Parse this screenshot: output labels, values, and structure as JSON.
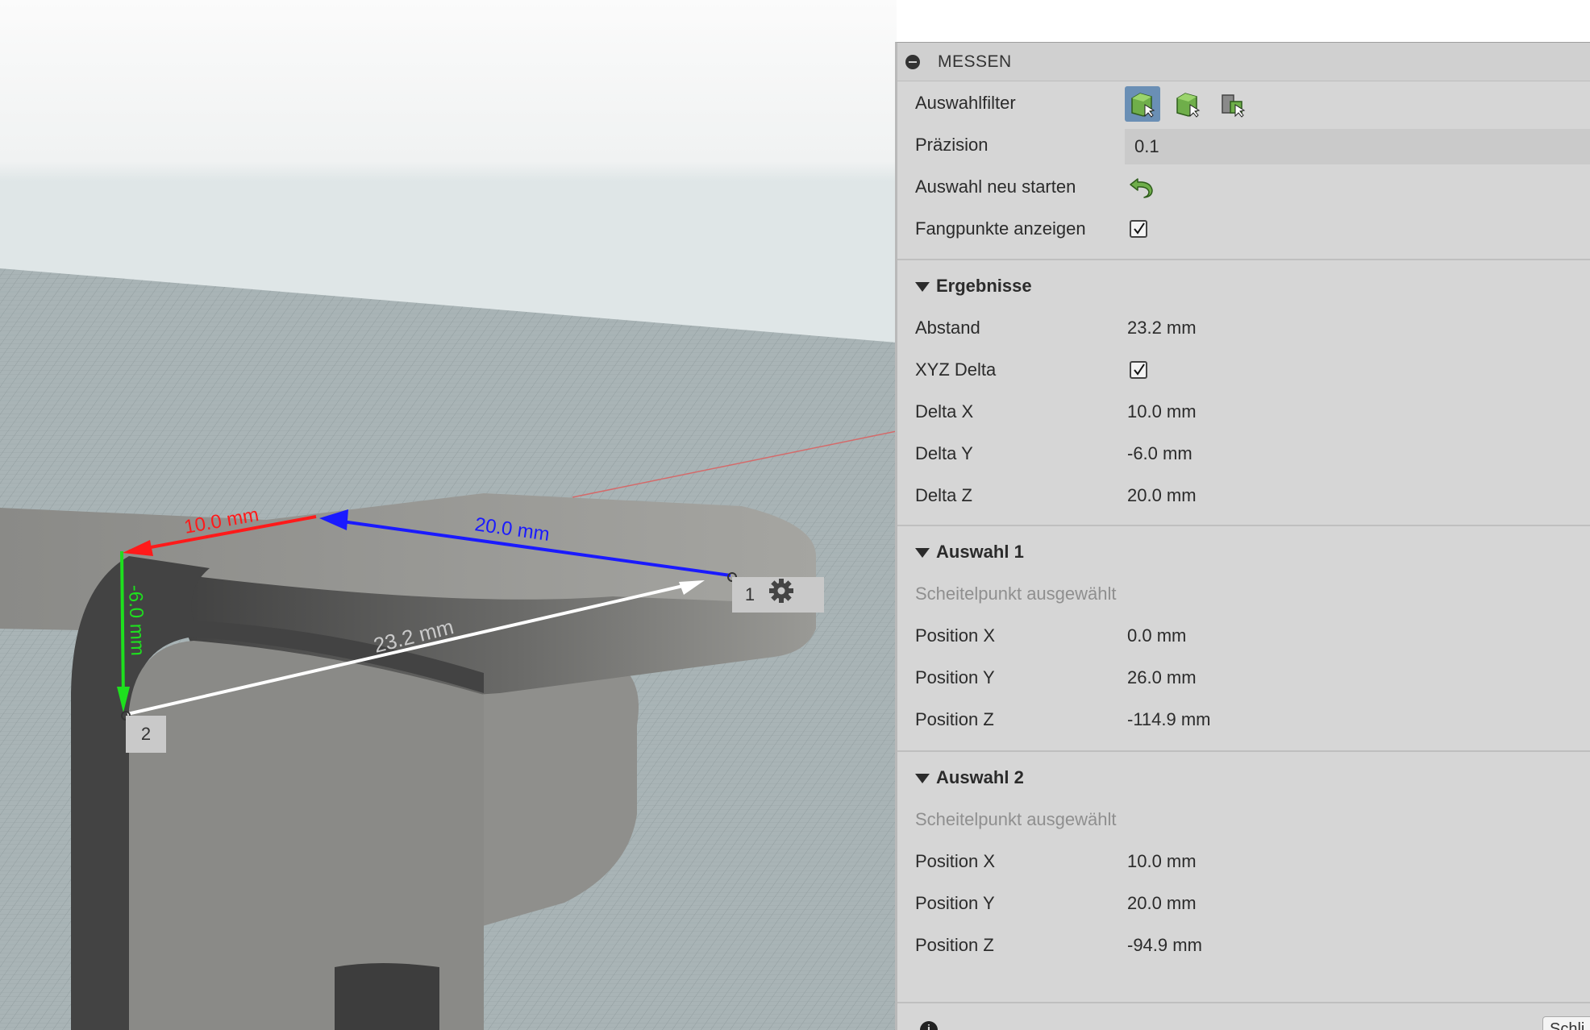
{
  "viewport": {
    "dimensions": {
      "delta_x": "10.0 mm",
      "delta_z": "20.0 mm",
      "delta_y": "-6.0 mm",
      "distance": "23.2 mm"
    },
    "point_labels": [
      "1",
      "2"
    ],
    "colors": {
      "x_axis": "#ff1a1a",
      "y_axis": "#1ee01e",
      "z_axis": "#1a1aff",
      "distance": "#ffffff",
      "model": "#8e8e8b",
      "model_dark": "#444444",
      "grid": "#9aa7a9"
    }
  },
  "panel": {
    "title": "MESSEN",
    "selection_filter": {
      "label": "Auswahlfilter",
      "icons": [
        "select-face-icon",
        "select-body-icon",
        "select-component-icon"
      ]
    },
    "precision": {
      "label": "Präzision",
      "value": "0.1"
    },
    "reset_selection": {
      "label": "Auswahl neu starten",
      "icon": "undo-arrow-icon"
    },
    "show_snap_points": {
      "label": "Fangpunkte anzeigen",
      "checked": true
    },
    "results": {
      "heading": "Ergebnisse",
      "distance_label": "Abstand",
      "distance_value": "23.2 mm",
      "xyz_delta_label": "XYZ Delta",
      "xyz_delta_checked": true,
      "delta_x_label": "Delta X",
      "delta_x_value": "10.0 mm",
      "delta_y_label": "Delta Y",
      "delta_y_value": "-6.0 mm",
      "delta_z_label": "Delta Z",
      "delta_z_value": "20.0 mm"
    },
    "selection1": {
      "heading": "Auswahl 1",
      "status": "Scheitelpunkt ausgewählt",
      "pos_x_label": "Position X",
      "pos_x_value": "0.0 mm",
      "pos_y_label": "Position Y",
      "pos_y_value": "26.0 mm",
      "pos_z_label": "Position Z",
      "pos_z_value": "-114.9 mm"
    },
    "selection2": {
      "heading": "Auswahl 2",
      "status": "Scheitelpunkt ausgewählt",
      "pos_x_label": "Position X",
      "pos_x_value": "10.0 mm",
      "pos_y_label": "Position Y",
      "pos_y_value": "20.0 mm",
      "pos_z_label": "Position Z",
      "pos_z_value": "-94.9 mm"
    },
    "close_button_label": "Schli",
    "accent_color": "#6a8fb5"
  }
}
